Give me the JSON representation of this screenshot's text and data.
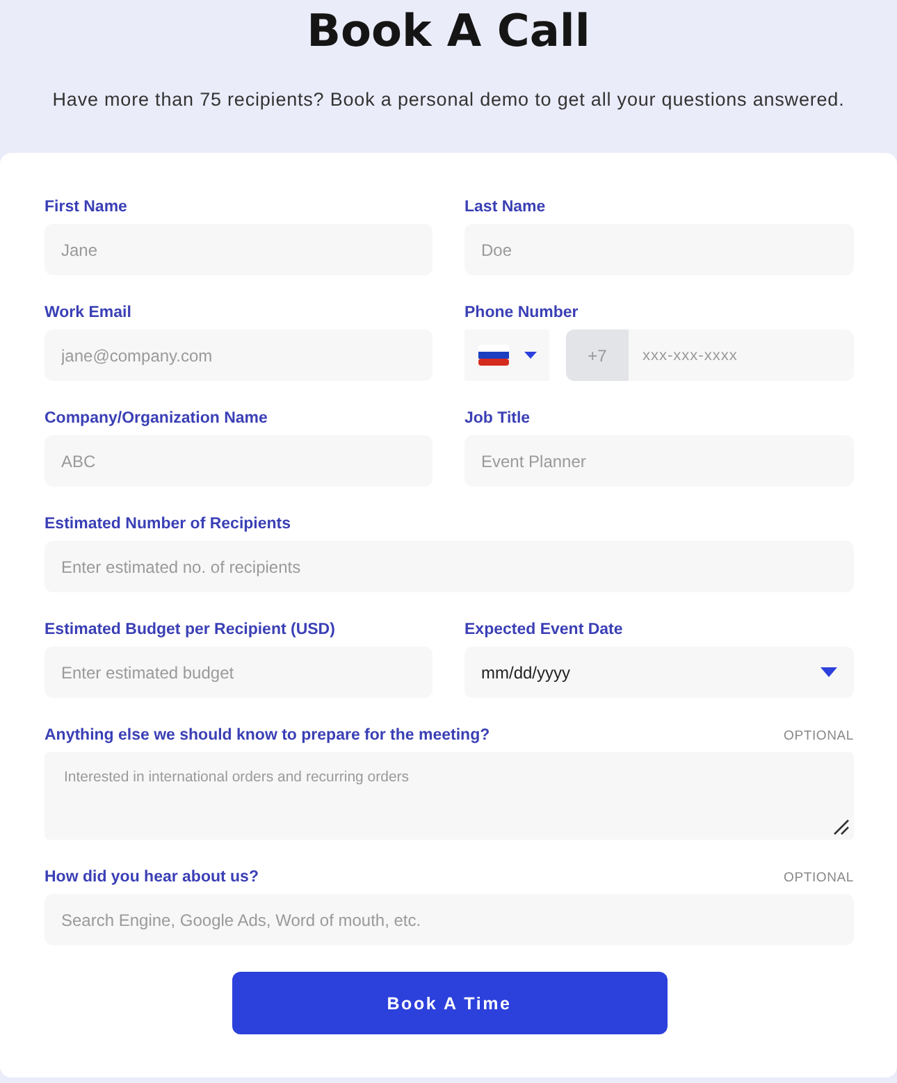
{
  "header": {
    "title": "Book A Call",
    "subtitle": "Have more than 75 recipients? Book a personal demo to get all your questions answered."
  },
  "fields": [
    {
      "kind": "text",
      "wide": false,
      "label": "First Name",
      "placeholder": "Jane"
    },
    {
      "kind": "text",
      "wide": false,
      "label": "Last Name",
      "placeholder": "Doe"
    },
    {
      "kind": "text",
      "wide": false,
      "label": "Work Email",
      "placeholder": "jane@company.com"
    },
    {
      "kind": "phone",
      "wide": false,
      "label": "Phone Number",
      "dial_code": "+7",
      "placeholder": "xxx-xxx-xxxx"
    },
    {
      "kind": "text",
      "wide": false,
      "label": "Company/Organization Name",
      "placeholder": "ABC"
    },
    {
      "kind": "text",
      "wide": false,
      "label": "Job Title",
      "placeholder": "Event Planner"
    },
    {
      "kind": "text",
      "wide": true,
      "label": "Estimated Number of Recipients",
      "placeholder": "Enter estimated no. of recipients"
    },
    {
      "kind": "text",
      "wide": false,
      "label": "Estimated Budget per Recipient (USD)",
      "placeholder": "Enter estimated budget"
    },
    {
      "kind": "date",
      "wide": false,
      "label": "Expected Event Date",
      "value": "mm/dd/yyyy"
    },
    {
      "kind": "textarea",
      "wide": true,
      "label": "Anything else we should know to prepare for the meeting?",
      "optional": "OPTIONAL",
      "placeholder": "Interested in international orders and recurring orders"
    },
    {
      "kind": "text",
      "wide": true,
      "label": "How did you hear about us?",
      "optional": "OPTIONAL",
      "placeholder": "Search Engine, Google Ads, Word of mouth, etc."
    }
  ],
  "submit": "Book A Time"
}
